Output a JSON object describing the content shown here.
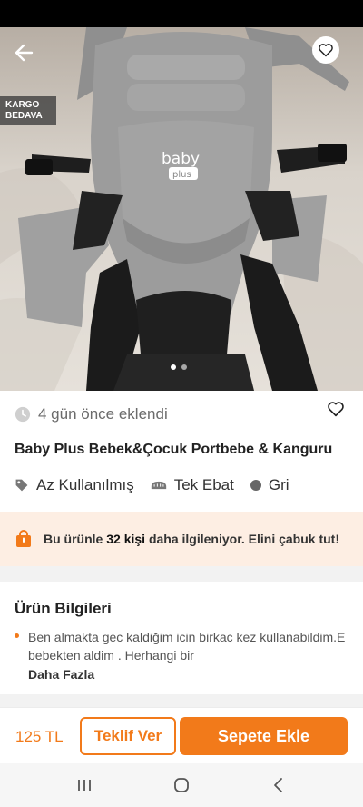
{
  "badges": {
    "cargo_line1": "KARGO",
    "cargo_line2": "BEDAVA"
  },
  "gallery": {
    "dot_count": 2,
    "active_dot": 0
  },
  "listing": {
    "added": "4 gün önce eklendi",
    "title": "Baby Plus Bebek&Çocuk Portbebe & Kanguru",
    "condition": "Az Kullanılmış",
    "size": "Tek Ebat",
    "color": "Gri"
  },
  "interest": {
    "prefix": "Bu ürünle ",
    "count": "32 kişi",
    "suffix": " daha ilgileniyor. Elini çabuk tut!"
  },
  "product_info": {
    "title": "Ürün Bilgileri",
    "description": "Ben almakta gec kaldiğim icin birkac kez kullanabildim.E bebekten aldim . Herhangi bir",
    "more": "Daha Fazla"
  },
  "bottom_bar": {
    "price": "125 TL",
    "offer_label": "Teklif Ver",
    "cart_label": "Sepete Ekle"
  },
  "colors": {
    "accent": "#f27a1a",
    "banner_bg": "#fdeee3",
    "carrier_gray": "#9e9e9e"
  },
  "icons": [
    "back-arrow-icon",
    "heart-icon",
    "clock-icon",
    "tag-icon",
    "ruler-icon",
    "color-dot-icon",
    "shopping-bag-icon",
    "recents-icon",
    "home-icon",
    "back-icon"
  ]
}
